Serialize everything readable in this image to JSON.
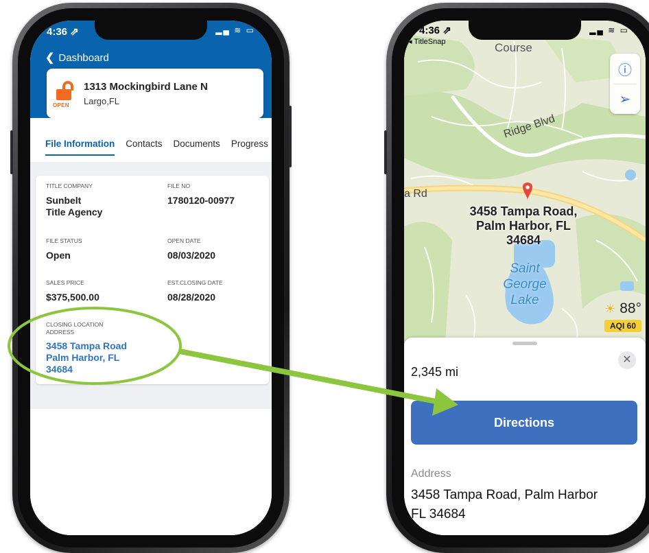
{
  "left_phone": {
    "status": {
      "time": "4:36 ⇗",
      "icons": "▂▄ ≋ ▭"
    },
    "back_label": "Dashboard",
    "file": {
      "status_badge": "OPEN",
      "address_line1": "1313 Mockingbird Lane N",
      "address_line2": "Largo,FL"
    },
    "tabs": [
      "File Information",
      "Contacts",
      "Documents",
      "Progress"
    ],
    "fields": {
      "title_company": {
        "label": "TITLE COMPANY",
        "value": "Sunbelt\nTitle Agency"
      },
      "file_no": {
        "label": "FILE NO",
        "value": "1780120-00977"
      },
      "file_status": {
        "label": "FILE STATUS",
        "value": "Open"
      },
      "open_date": {
        "label": "OPEN DATE",
        "value": "08/03/2020"
      },
      "sales_price": {
        "label": "SALES PRICE",
        "value": "$375,500.00"
      },
      "est_closing_date": {
        "label": "EST.CLOSING DATE",
        "value": "08/28/2020"
      },
      "closing_location": {
        "label": "CLOSING LOCATION\nADDRESS",
        "value": "3458 Tampa Road\nPalm Harbor, FL\n34684"
      }
    }
  },
  "right_phone": {
    "status": {
      "time": "4:36 ⇗",
      "icons": "▂▄ ≋ ▭"
    },
    "back_app": "◂ TitleSnap",
    "map": {
      "road_labels": {
        "course": "Course",
        "ridge": "Ridge Blvd",
        "tampa": "a Rd"
      },
      "pin_label": "3458 Tampa Road,\nPalm Harbor, FL\n34684",
      "lake_label": "Saint\nGeorge\nLake",
      "weather": {
        "temp": "88°",
        "aqi": "AQI 60"
      }
    },
    "sheet": {
      "distance": "2,345 mi",
      "directions_label": "Directions",
      "address_label": "Address",
      "address_value": "3458 Tampa Road, Palm Harbor\nFL 34684"
    }
  },
  "colors": {
    "brand_blue": "#0a63ad",
    "accent_orange": "#f26b21",
    "annotation_green": "#8cc63f",
    "directions_blue": "#3d70bf"
  }
}
